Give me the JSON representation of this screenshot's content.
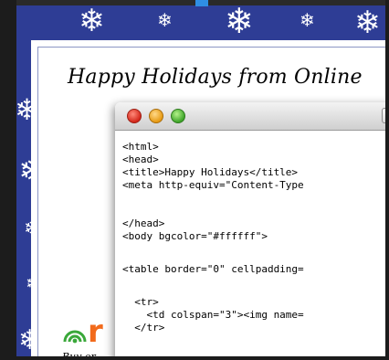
{
  "card": {
    "title": "Happy Holidays from Online"
  },
  "window": {
    "code_lines": [
      "<html>",
      "<head>",
      "<title>Happy Holidays</title>",
      "<meta http-equiv=\"Content-Type",
      "",
      "</head>",
      "<body bgcolor=\"#ffffff\">",
      "",
      "<table border=\"0\" cellpadding=",
      "",
      "  <tr>",
      "    <td colspan=\"3\"><img name=",
      "  </tr>"
    ]
  },
  "footer": {
    "logo_letter": "r",
    "tagline": "Buy or"
  },
  "icons": [
    "snowflake-icon",
    "logo-ring-icon"
  ],
  "colors": {
    "frame_blue": "#2e3d95",
    "logo_green": "#3aa83a",
    "logo_orange": "#f26a1b",
    "code_text": "#000000"
  }
}
